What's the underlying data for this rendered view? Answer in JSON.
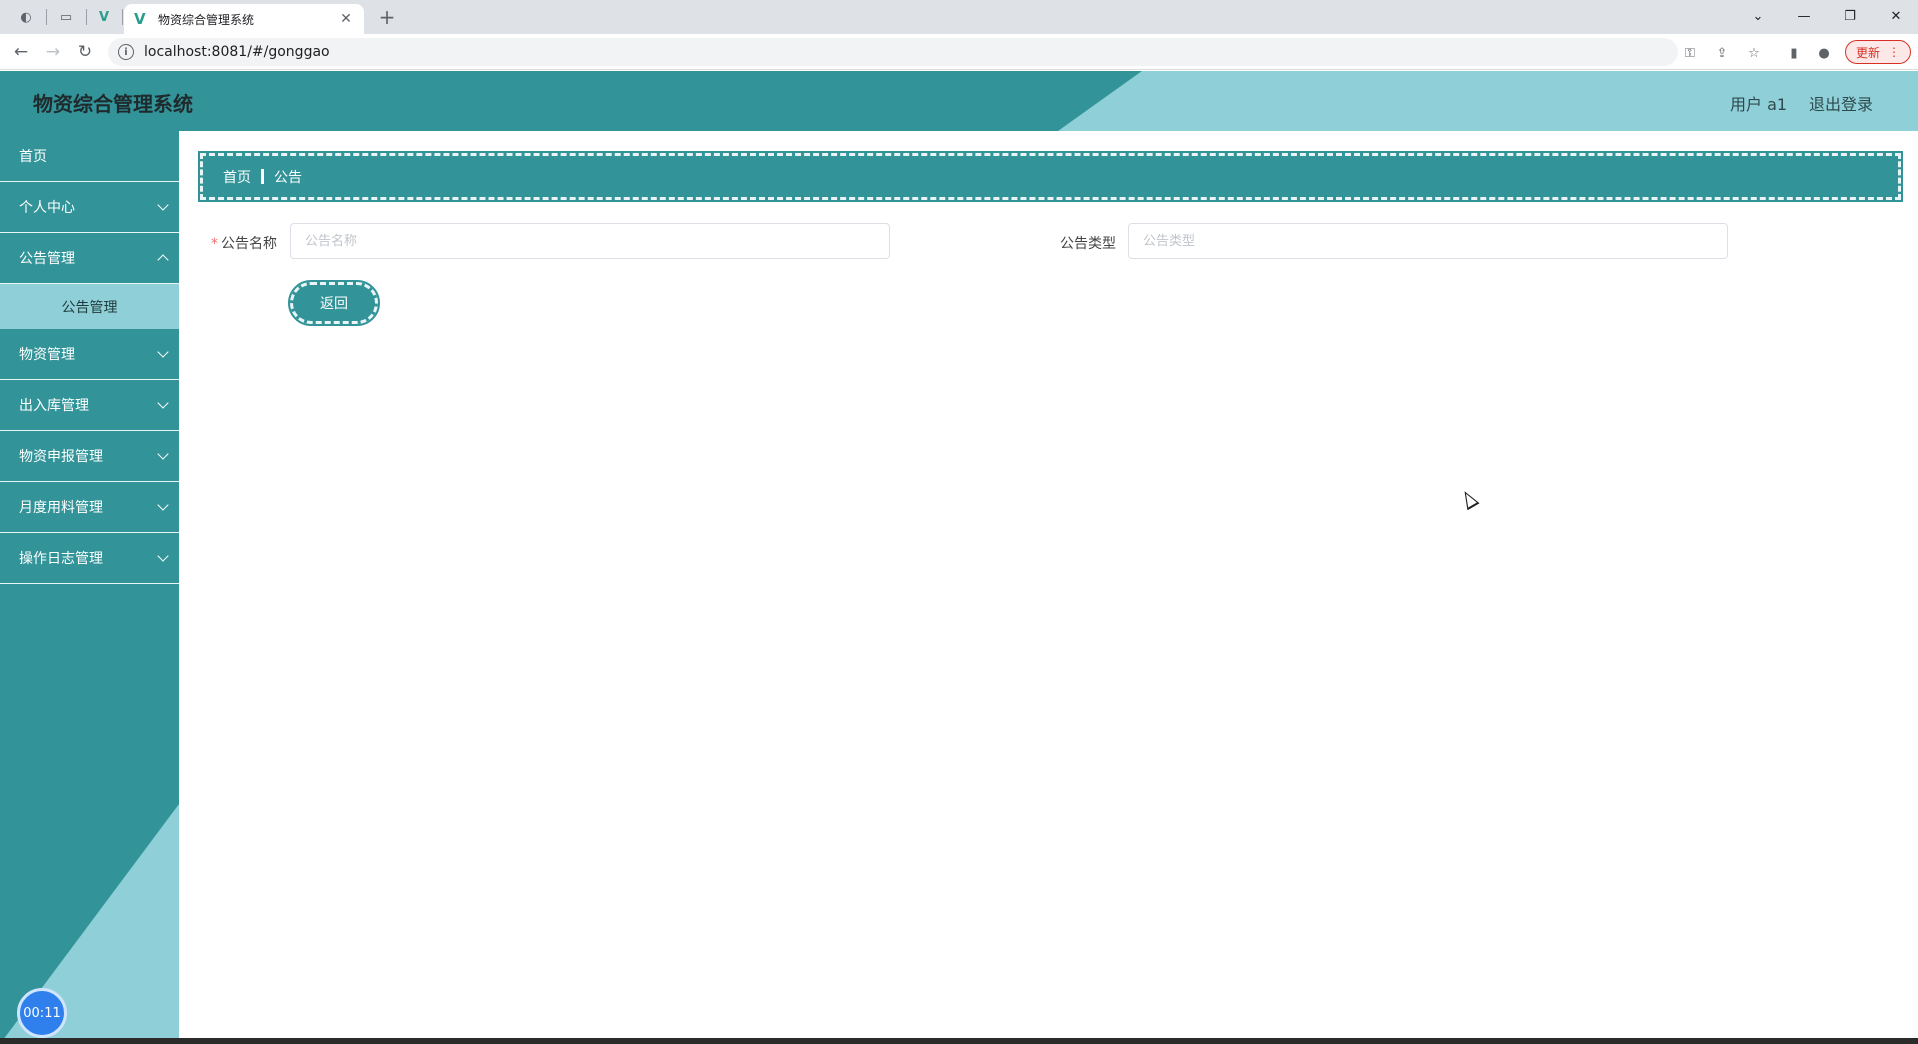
{
  "browser": {
    "tab_title": "物资综合管理系统",
    "url": "localhost:8081/#/gonggao",
    "update_label": "更新"
  },
  "app": {
    "title": "物资综合管理系统",
    "user_label": "用户 a1",
    "logout_label": "退出登录"
  },
  "sidebar": {
    "items": [
      {
        "label": "首页"
      },
      {
        "label": "个人中心"
      },
      {
        "label": "公告管理"
      },
      {
        "label": "物资管理"
      },
      {
        "label": "出入库管理"
      },
      {
        "label": "物资申报管理"
      },
      {
        "label": "月度用料管理"
      },
      {
        "label": "操作日志管理"
      }
    ],
    "subitem_gonggao": "公告管理",
    "timer": "00:11"
  },
  "breadcrumb": {
    "home": "首页",
    "current": "公告"
  },
  "form": {
    "name_label": "公告名称",
    "name_placeholder": "公告名称",
    "type_label": "公告类型",
    "type_placeholder": "公告类型",
    "back_label": "返回"
  }
}
